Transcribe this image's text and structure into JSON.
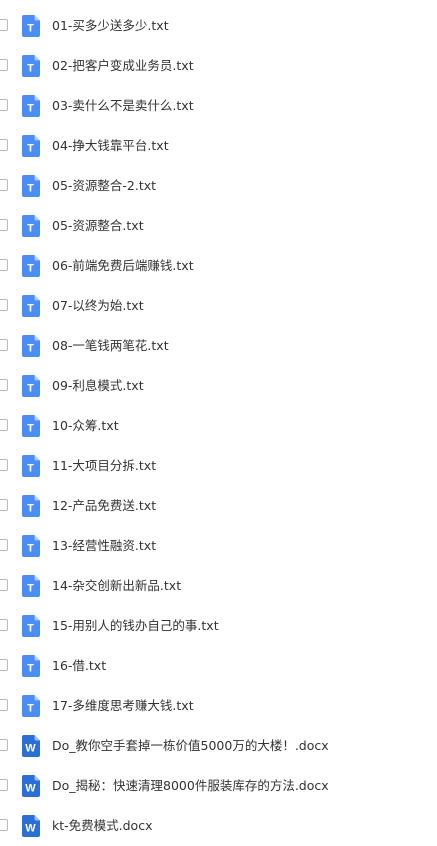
{
  "colors": {
    "txt_icon": "#4a8ef5",
    "docx_icon": "#2b6fd6",
    "text": "#333333",
    "checkbox_border": "#b9b9b9"
  },
  "files": [
    {
      "name": "01-买多少送多少.txt",
      "icon": "txt-file-icon",
      "letter": "T"
    },
    {
      "name": "02-把客户变成业务员.txt",
      "icon": "txt-file-icon",
      "letter": "T"
    },
    {
      "name": "03-卖什么不是卖什么.txt",
      "icon": "txt-file-icon",
      "letter": "T"
    },
    {
      "name": "04-挣大钱靠平台.txt",
      "icon": "txt-file-icon",
      "letter": "T"
    },
    {
      "name": "05-资源整合-2.txt",
      "icon": "txt-file-icon",
      "letter": "T"
    },
    {
      "name": "05-资源整合.txt",
      "icon": "txt-file-icon",
      "letter": "T"
    },
    {
      "name": "06-前端免费后端赚钱.txt",
      "icon": "txt-file-icon",
      "letter": "T"
    },
    {
      "name": "07-以终为始.txt",
      "icon": "txt-file-icon",
      "letter": "T"
    },
    {
      "name": "08-一笔钱两笔花.txt",
      "icon": "txt-file-icon",
      "letter": "T"
    },
    {
      "name": "09-利息模式.txt",
      "icon": "txt-file-icon",
      "letter": "T"
    },
    {
      "name": "10-众筹.txt",
      "icon": "txt-file-icon",
      "letter": "T"
    },
    {
      "name": "11-大项目分拆.txt",
      "icon": "txt-file-icon",
      "letter": "T"
    },
    {
      "name": "12-产品免费送.txt",
      "icon": "txt-file-icon",
      "letter": "T"
    },
    {
      "name": "13-经营性融资.txt",
      "icon": "txt-file-icon",
      "letter": "T"
    },
    {
      "name": "14-杂交创新出新品.txt",
      "icon": "txt-file-icon",
      "letter": "T"
    },
    {
      "name": "15-用别人的钱办自己的事.txt",
      "icon": "txt-file-icon",
      "letter": "T"
    },
    {
      "name": "16-借.txt",
      "icon": "txt-file-icon",
      "letter": "T"
    },
    {
      "name": "17-多维度思考赚大钱.txt",
      "icon": "txt-file-icon",
      "letter": "T"
    },
    {
      "name": "Do_教你空手套掉一栋价值5000万的大楼！.docx",
      "icon": "word-file-icon",
      "letter": "W"
    },
    {
      "name": "Do_揭秘：快速清理8000件服装库存的方法.docx",
      "icon": "word-file-icon",
      "letter": "W"
    },
    {
      "name": "kt-免费模式.docx",
      "icon": "word-file-icon",
      "letter": "W"
    }
  ]
}
